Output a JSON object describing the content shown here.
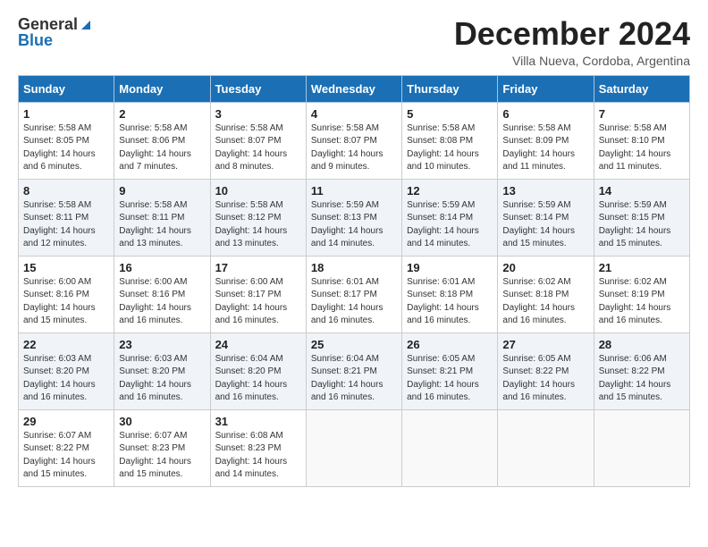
{
  "header": {
    "logo_general": "General",
    "logo_blue": "Blue",
    "month_title": "December 2024",
    "location": "Villa Nueva, Cordoba, Argentina"
  },
  "weekdays": [
    "Sunday",
    "Monday",
    "Tuesday",
    "Wednesday",
    "Thursday",
    "Friday",
    "Saturday"
  ],
  "weeks": [
    [
      {
        "day": "1",
        "sunrise": "Sunrise: 5:58 AM",
        "sunset": "Sunset: 8:05 PM",
        "daylight": "Daylight: 14 hours and 6 minutes."
      },
      {
        "day": "2",
        "sunrise": "Sunrise: 5:58 AM",
        "sunset": "Sunset: 8:06 PM",
        "daylight": "Daylight: 14 hours and 7 minutes."
      },
      {
        "day": "3",
        "sunrise": "Sunrise: 5:58 AM",
        "sunset": "Sunset: 8:07 PM",
        "daylight": "Daylight: 14 hours and 8 minutes."
      },
      {
        "day": "4",
        "sunrise": "Sunrise: 5:58 AM",
        "sunset": "Sunset: 8:07 PM",
        "daylight": "Daylight: 14 hours and 9 minutes."
      },
      {
        "day": "5",
        "sunrise": "Sunrise: 5:58 AM",
        "sunset": "Sunset: 8:08 PM",
        "daylight": "Daylight: 14 hours and 10 minutes."
      },
      {
        "day": "6",
        "sunrise": "Sunrise: 5:58 AM",
        "sunset": "Sunset: 8:09 PM",
        "daylight": "Daylight: 14 hours and 11 minutes."
      },
      {
        "day": "7",
        "sunrise": "Sunrise: 5:58 AM",
        "sunset": "Sunset: 8:10 PM",
        "daylight": "Daylight: 14 hours and 11 minutes."
      }
    ],
    [
      {
        "day": "8",
        "sunrise": "Sunrise: 5:58 AM",
        "sunset": "Sunset: 8:11 PM",
        "daylight": "Daylight: 14 hours and 12 minutes."
      },
      {
        "day": "9",
        "sunrise": "Sunrise: 5:58 AM",
        "sunset": "Sunset: 8:11 PM",
        "daylight": "Daylight: 14 hours and 13 minutes."
      },
      {
        "day": "10",
        "sunrise": "Sunrise: 5:58 AM",
        "sunset": "Sunset: 8:12 PM",
        "daylight": "Daylight: 14 hours and 13 minutes."
      },
      {
        "day": "11",
        "sunrise": "Sunrise: 5:59 AM",
        "sunset": "Sunset: 8:13 PM",
        "daylight": "Daylight: 14 hours and 14 minutes."
      },
      {
        "day": "12",
        "sunrise": "Sunrise: 5:59 AM",
        "sunset": "Sunset: 8:14 PM",
        "daylight": "Daylight: 14 hours and 14 minutes."
      },
      {
        "day": "13",
        "sunrise": "Sunrise: 5:59 AM",
        "sunset": "Sunset: 8:14 PM",
        "daylight": "Daylight: 14 hours and 15 minutes."
      },
      {
        "day": "14",
        "sunrise": "Sunrise: 5:59 AM",
        "sunset": "Sunset: 8:15 PM",
        "daylight": "Daylight: 14 hours and 15 minutes."
      }
    ],
    [
      {
        "day": "15",
        "sunrise": "Sunrise: 6:00 AM",
        "sunset": "Sunset: 8:16 PM",
        "daylight": "Daylight: 14 hours and 15 minutes."
      },
      {
        "day": "16",
        "sunrise": "Sunrise: 6:00 AM",
        "sunset": "Sunset: 8:16 PM",
        "daylight": "Daylight: 14 hours and 16 minutes."
      },
      {
        "day": "17",
        "sunrise": "Sunrise: 6:00 AM",
        "sunset": "Sunset: 8:17 PM",
        "daylight": "Daylight: 14 hours and 16 minutes."
      },
      {
        "day": "18",
        "sunrise": "Sunrise: 6:01 AM",
        "sunset": "Sunset: 8:17 PM",
        "daylight": "Daylight: 14 hours and 16 minutes."
      },
      {
        "day": "19",
        "sunrise": "Sunrise: 6:01 AM",
        "sunset": "Sunset: 8:18 PM",
        "daylight": "Daylight: 14 hours and 16 minutes."
      },
      {
        "day": "20",
        "sunrise": "Sunrise: 6:02 AM",
        "sunset": "Sunset: 8:18 PM",
        "daylight": "Daylight: 14 hours and 16 minutes."
      },
      {
        "day": "21",
        "sunrise": "Sunrise: 6:02 AM",
        "sunset": "Sunset: 8:19 PM",
        "daylight": "Daylight: 14 hours and 16 minutes."
      }
    ],
    [
      {
        "day": "22",
        "sunrise": "Sunrise: 6:03 AM",
        "sunset": "Sunset: 8:20 PM",
        "daylight": "Daylight: 14 hours and 16 minutes."
      },
      {
        "day": "23",
        "sunrise": "Sunrise: 6:03 AM",
        "sunset": "Sunset: 8:20 PM",
        "daylight": "Daylight: 14 hours and 16 minutes."
      },
      {
        "day": "24",
        "sunrise": "Sunrise: 6:04 AM",
        "sunset": "Sunset: 8:20 PM",
        "daylight": "Daylight: 14 hours and 16 minutes."
      },
      {
        "day": "25",
        "sunrise": "Sunrise: 6:04 AM",
        "sunset": "Sunset: 8:21 PM",
        "daylight": "Daylight: 14 hours and 16 minutes."
      },
      {
        "day": "26",
        "sunrise": "Sunrise: 6:05 AM",
        "sunset": "Sunset: 8:21 PM",
        "daylight": "Daylight: 14 hours and 16 minutes."
      },
      {
        "day": "27",
        "sunrise": "Sunrise: 6:05 AM",
        "sunset": "Sunset: 8:22 PM",
        "daylight": "Daylight: 14 hours and 16 minutes."
      },
      {
        "day": "28",
        "sunrise": "Sunrise: 6:06 AM",
        "sunset": "Sunset: 8:22 PM",
        "daylight": "Daylight: 14 hours and 15 minutes."
      }
    ],
    [
      {
        "day": "29",
        "sunrise": "Sunrise: 6:07 AM",
        "sunset": "Sunset: 8:22 PM",
        "daylight": "Daylight: 14 hours and 15 minutes."
      },
      {
        "day": "30",
        "sunrise": "Sunrise: 6:07 AM",
        "sunset": "Sunset: 8:23 PM",
        "daylight": "Daylight: 14 hours and 15 minutes."
      },
      {
        "day": "31",
        "sunrise": "Sunrise: 6:08 AM",
        "sunset": "Sunset: 8:23 PM",
        "daylight": "Daylight: 14 hours and 14 minutes."
      },
      null,
      null,
      null,
      null
    ]
  ]
}
